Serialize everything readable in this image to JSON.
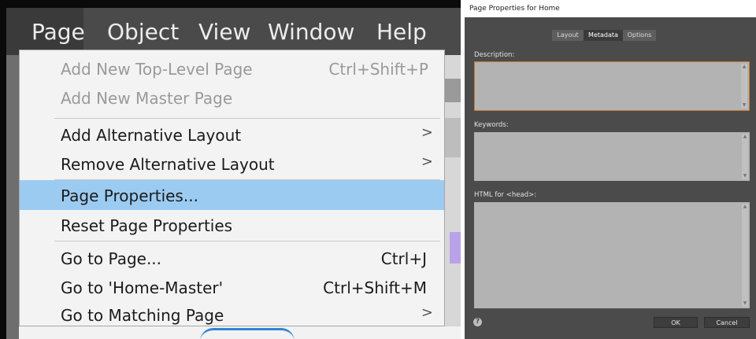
{
  "menubar": {
    "items": [
      {
        "label": "Page",
        "active": true
      },
      {
        "label": "Object"
      },
      {
        "label": "View"
      },
      {
        "label": "Window"
      },
      {
        "label": "Help"
      }
    ]
  },
  "page_menu": {
    "items": [
      {
        "label": "Add New Top-Level Page",
        "shortcut": "Ctrl+Shift+P",
        "disabled": true
      },
      {
        "label": "Add New Master Page",
        "disabled": true
      },
      {
        "label": "Add Alternative Layout",
        "submenu": true
      },
      {
        "label": "Remove Alternative Layout",
        "submenu": true
      },
      {
        "label": "Page Properties...",
        "highlighted": true
      },
      {
        "label": "Reset Page Properties"
      },
      {
        "label": "Go to Page...",
        "shortcut": "Ctrl+J"
      },
      {
        "label": "Go to 'Home-Master'",
        "shortcut": "Ctrl+Shift+M"
      },
      {
        "label": "Go to Matching Page",
        "submenu": true
      }
    ],
    "submenu_arrow": ">"
  },
  "dialog": {
    "title": "Page Properties for Home",
    "tabs": [
      {
        "label": "Layout"
      },
      {
        "label": "Metadata",
        "active": true
      },
      {
        "label": "Options"
      }
    ],
    "description_label": "Description:",
    "keywords_label": "Keywords:",
    "head_html_label": "HTML for <head>:",
    "help_icon": "?",
    "ok_label": "OK",
    "cancel_label": "Cancel"
  },
  "colors": {
    "menubar_bg": "#4a4a4a",
    "menu_bg": "#f3f3f3",
    "menu_highlight": "#9ccbf2",
    "dialog_bg": "#4b4b4b",
    "field_bg": "#b3b3b3",
    "focus_border": "#c87a2e"
  }
}
